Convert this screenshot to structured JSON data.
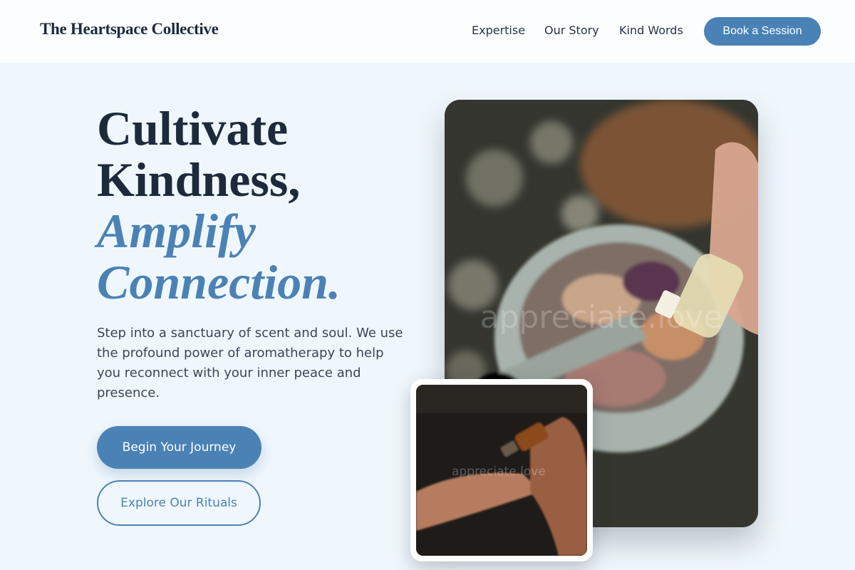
{
  "nav": {
    "brand": "The Heartspace Collective",
    "links": [
      "Expertise",
      "Our Story",
      "Kind Words"
    ],
    "cta": "Book a Session"
  },
  "hero": {
    "line1": "Cultivate",
    "line2": "Kindness,",
    "line3": "Amplify",
    "line4": "Connection.",
    "lede": "Step into a sanctuary of scent and soul. We use the profound power of aromatherapy to help you reconnect with your inner peace and presence.",
    "primary_cta": "Begin Your Journey",
    "secondary_cta": "Explore Our Rituals"
  },
  "images": {
    "watermark": "appreciate.love"
  },
  "colors": {
    "accent": "#4a82b6",
    "text": "#1e2a3c",
    "background": "#f0f7fc"
  }
}
